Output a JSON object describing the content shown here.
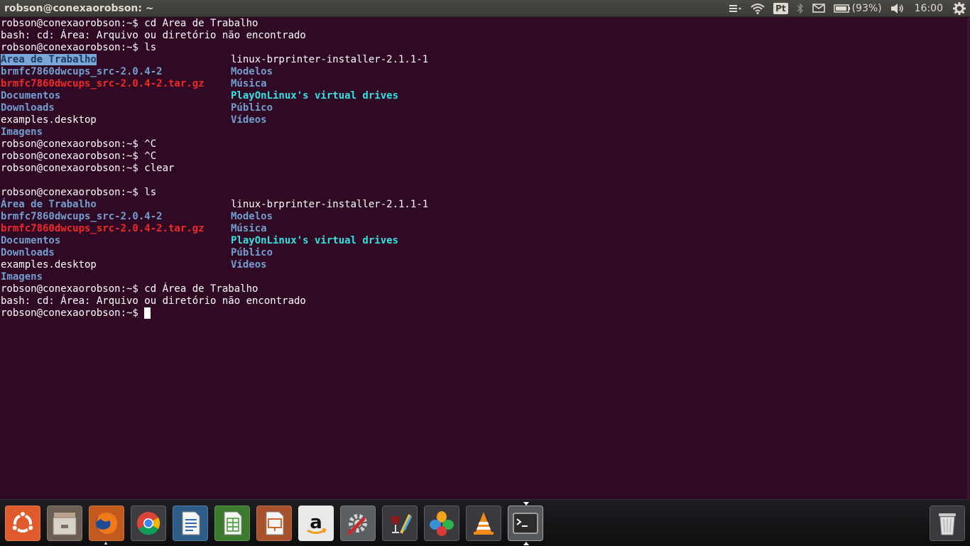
{
  "window": {
    "title": "robson@conexaorobson: ~"
  },
  "panel": {
    "keyboard_layout": "Pt",
    "battery_text": "(93%)",
    "battery_level_percent": 93,
    "clock": "16:00",
    "icons": [
      "menu-icon",
      "wifi-icon",
      "keyboard-layout-indicator",
      "bluetooth-icon",
      "mail-icon",
      "battery-icon",
      "volume-icon",
      "power-gear-icon"
    ]
  },
  "terminal": {
    "lines": [
      {
        "type": "text",
        "text": "robson@conexaorobson:~$ cd Área de Trabalho"
      },
      {
        "type": "text",
        "text": "bash: cd: Área: Arquivo ou diretório não encontrado"
      },
      {
        "type": "text",
        "text": "robson@conexaorobson:~$ ls"
      },
      {
        "type": "cols",
        "left": {
          "text": "Área de Trabalho",
          "style": "dir hl"
        },
        "right": {
          "text": "linux-brprinter-installer-2.1.1-1",
          "style": "plain"
        }
      },
      {
        "type": "cols",
        "left": {
          "text": "brmfc7860dwcups_src-2.0.4-2",
          "style": "dir"
        },
        "right": {
          "text": "Modelos",
          "style": "dir"
        }
      },
      {
        "type": "cols",
        "left": {
          "text": "brmfc7860dwcups_src-2.0.4-2.tar.gz",
          "style": "arc"
        },
        "right": {
          "text": "Música",
          "style": "dir"
        }
      },
      {
        "type": "cols",
        "left": {
          "text": "Documentos",
          "style": "dir"
        },
        "right": {
          "text": "PlayOnLinux's virtual drives",
          "style": "share"
        }
      },
      {
        "type": "cols",
        "left": {
          "text": "Downloads",
          "style": "dir"
        },
        "right": {
          "text": "Público",
          "style": "dir"
        }
      },
      {
        "type": "cols",
        "left": {
          "text": "examples.desktop",
          "style": "plain"
        },
        "right": {
          "text": "Vídeos",
          "style": "dir"
        }
      },
      {
        "type": "cols",
        "left": {
          "text": "Imagens",
          "style": "dir"
        },
        "right": {
          "text": "",
          "style": "plain"
        }
      },
      {
        "type": "text",
        "text": "robson@conexaorobson:~$ ^C"
      },
      {
        "type": "text",
        "text": "robson@conexaorobson:~$ ^C"
      },
      {
        "type": "text",
        "text": "robson@conexaorobson:~$ clear"
      },
      {
        "type": "text",
        "text": ""
      },
      {
        "type": "text",
        "text": "robson@conexaorobson:~$ ls"
      },
      {
        "type": "cols",
        "left": {
          "text": "Área de Trabalho",
          "style": "dir"
        },
        "right": {
          "text": "linux-brprinter-installer-2.1.1-1",
          "style": "plain"
        }
      },
      {
        "type": "cols",
        "left": {
          "text": "brmfc7860dwcups_src-2.0.4-2",
          "style": "dir"
        },
        "right": {
          "text": "Modelos",
          "style": "dir"
        }
      },
      {
        "type": "cols",
        "left": {
          "text": "brmfc7860dwcups_src-2.0.4-2.tar.gz",
          "style": "arc"
        },
        "right": {
          "text": "Música",
          "style": "dir"
        }
      },
      {
        "type": "cols",
        "left": {
          "text": "Documentos",
          "style": "dir"
        },
        "right": {
          "text": "PlayOnLinux's virtual drives",
          "style": "share"
        }
      },
      {
        "type": "cols",
        "left": {
          "text": "Downloads",
          "style": "dir"
        },
        "right": {
          "text": "Público",
          "style": "dir"
        }
      },
      {
        "type": "cols",
        "left": {
          "text": "examples.desktop",
          "style": "plain"
        },
        "right": {
          "text": "Vídeos",
          "style": "dir"
        }
      },
      {
        "type": "cols",
        "left": {
          "text": "Imagens",
          "style": "dir"
        },
        "right": {
          "text": "",
          "style": "plain"
        }
      },
      {
        "type": "text",
        "text": "robson@conexaorobson:~$ cd Área de Trabalho"
      },
      {
        "type": "text",
        "text": "bash: cd: Área: Arquivo ou diretório não encontrado"
      },
      {
        "type": "prompt",
        "text": "robson@conexaorobson:~$ "
      }
    ]
  },
  "launcher": {
    "items": [
      {
        "name": "ubuntu-dash-icon"
      },
      {
        "name": "files-icon"
      },
      {
        "name": "firefox-icon"
      },
      {
        "name": "chrome-icon"
      },
      {
        "name": "libreoffice-writer-icon"
      },
      {
        "name": "libreoffice-calc-icon"
      },
      {
        "name": "libreoffice-impress-icon"
      },
      {
        "name": "amazon-icon"
      },
      {
        "name": "system-settings-icon"
      },
      {
        "name": "wine-icon"
      },
      {
        "name": "playonlinux-icon"
      },
      {
        "name": "vlc-icon"
      },
      {
        "name": "terminal-icon"
      },
      {
        "name": "trash-icon"
      }
    ],
    "colors": {
      "dash": "#e05a2b",
      "active_bg": "#55595c"
    }
  }
}
